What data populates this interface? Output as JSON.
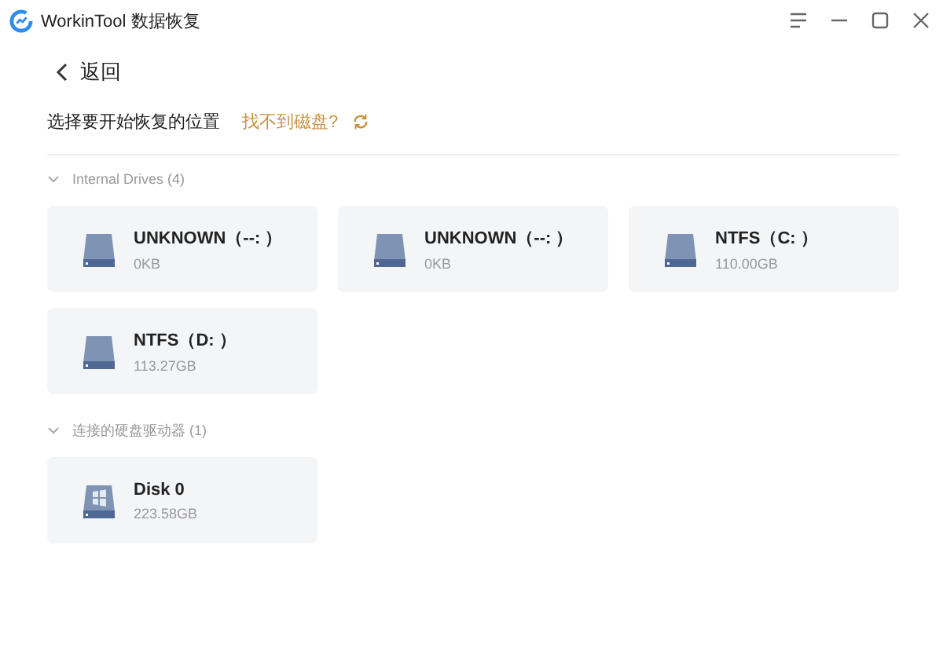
{
  "window": {
    "title": "WorkinTool 数据恢复"
  },
  "back": {
    "label": "返回"
  },
  "prompt": {
    "text": "选择要开始恢复的位置",
    "help_link": "找不到磁盘?"
  },
  "sections": [
    {
      "title": "Internal Drives (4)",
      "expanded": true,
      "drives": [
        {
          "kind": "partition",
          "name": "UNKNOWN（--: ）",
          "size": "0KB"
        },
        {
          "kind": "partition",
          "name": "UNKNOWN（--: ）",
          "size": "0KB"
        },
        {
          "kind": "partition",
          "name": "NTFS（C: ）",
          "size": "110.00GB"
        },
        {
          "kind": "partition",
          "name": "NTFS（D: ）",
          "size": "113.27GB"
        }
      ]
    },
    {
      "title": "连接的硬盘驱动器 (1)",
      "expanded": true,
      "drives": [
        {
          "kind": "disk",
          "name": "Disk 0",
          "size": "223.58GB"
        }
      ]
    }
  ]
}
